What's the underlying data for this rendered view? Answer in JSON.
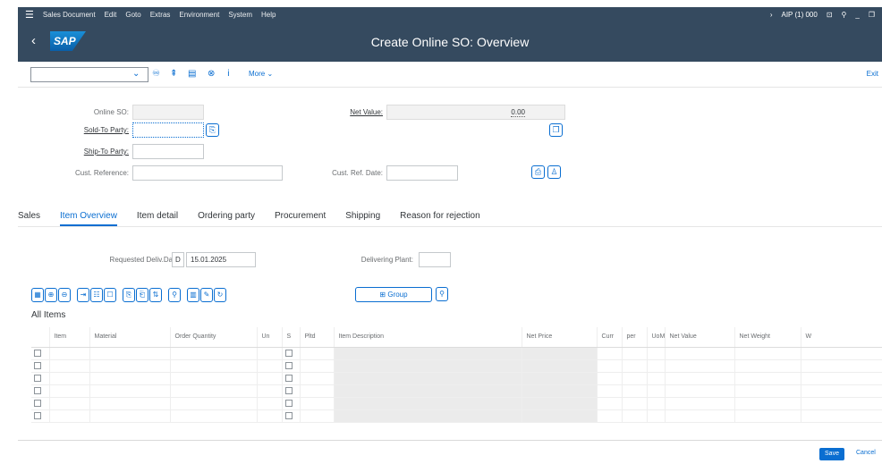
{
  "menubar": {
    "items": [
      "Sales Document",
      "Edit",
      "Goto",
      "Extras",
      "Environment",
      "System",
      "Help"
    ],
    "system_info": "AIP (1) 000"
  },
  "header": {
    "title": "Create Online SO: Overview",
    "logo": "SAP"
  },
  "toolbar": {
    "more_label": "More",
    "exit_label": "Exit"
  },
  "form": {
    "online_so_label": "Online SO:",
    "sold_to_party_label": "Sold-To Party:",
    "ship_to_party_label": "Ship-To Party:",
    "cust_reference_label": "Cust. Reference:",
    "net_value_label": "Net Value:",
    "net_value": "0.00",
    "cust_ref_date_label": "Cust. Ref. Date:"
  },
  "tabs": [
    "Sales",
    "Item Overview",
    "Item detail",
    "Ordering party",
    "Procurement",
    "Shipping",
    "Reason for rejection"
  ],
  "item_overview": {
    "req_deliv_date_label": "Requested Deliv.Date:",
    "req_deliv_date_type": "D",
    "req_deliv_date": "15.01.2025",
    "delivering_plant_label": "Delivering Plant:",
    "group_label": "Group",
    "all_items_label": "All Items"
  },
  "table": {
    "columns": [
      "Item",
      "Material",
      "Order Quantity",
      "Un",
      "S",
      "Pltd",
      "Item Description",
      "Net Price",
      "Curr",
      "per",
      "UoM",
      "Net Value",
      "Net Weight",
      "W"
    ]
  },
  "footer": {
    "save_label": "Save",
    "cancel_label": "Cancel"
  }
}
